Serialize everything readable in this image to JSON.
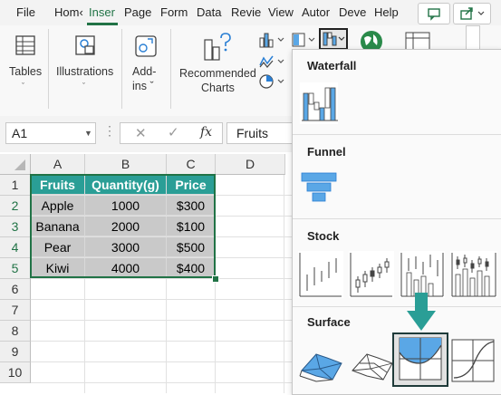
{
  "menubar": {
    "tabs": [
      "File",
      "Hom‹",
      "Inser",
      "Page",
      "Form",
      "Data",
      "Revie",
      "View",
      "Autor",
      "Deve",
      "Help"
    ],
    "active_tab_index": 2
  },
  "ribbon": {
    "tables_label": "Tables",
    "illustrations_label": "Illustrations",
    "addins_label_line1": "Add-",
    "addins_label_line2": "ins ˇ",
    "recommended_line1": "Recommended",
    "recommended_line2": "Charts"
  },
  "formula_bar": {
    "name_box": "A1",
    "fx_label": "fx",
    "formula_value": "Fruits"
  },
  "sheet": {
    "columns": [
      "A",
      "B",
      "C",
      "D"
    ],
    "rows": [
      "1",
      "2",
      "3",
      "4",
      "5",
      "6",
      "7",
      "8",
      "9",
      "10"
    ],
    "header": [
      "Fruits",
      "Quantity(g)",
      "Price"
    ],
    "data": [
      [
        "Apple",
        "1000",
        "$300"
      ],
      [
        "Banana",
        "2000",
        "$100"
      ],
      [
        "Pear",
        "3000",
        "$500"
      ],
      [
        "Kiwi",
        "4000",
        "$400"
      ]
    ]
  },
  "chart_menu": {
    "waterfall_title": "Waterfall",
    "funnel_title": "Funnel",
    "stock_title": "Stock",
    "surface_title": "Surface"
  },
  "colors": {
    "header_fill": "#2a9e96",
    "data_fill": "#c9c9c9",
    "excel_green": "#217346",
    "chart_blue": "#5aa7e6",
    "arrow_teal": "#2a9e96"
  }
}
